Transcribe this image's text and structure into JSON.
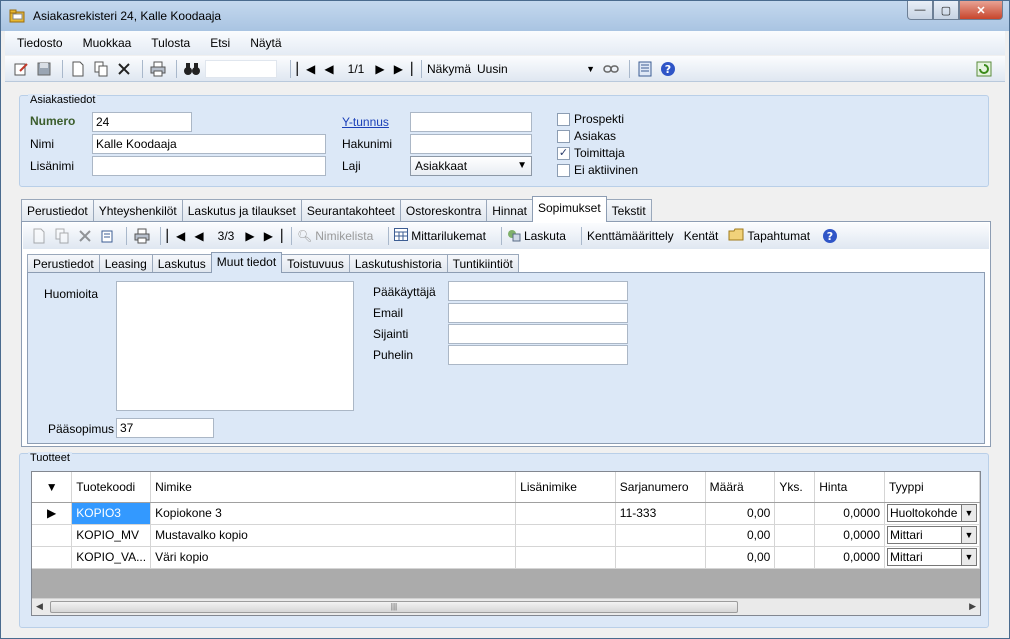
{
  "window": {
    "title": "Asiakasrekisteri 24, Kalle Koodaaja",
    "controls": {
      "minimize": "—",
      "maximize": "▢",
      "close": "✕"
    }
  },
  "menu": [
    "Tiedosto",
    "Muokkaa",
    "Tulosta",
    "Etsi",
    "Näytä"
  ],
  "toolbar": {
    "record_position": "1/1",
    "view_label": "Näkymä",
    "view_value": "Uusin"
  },
  "customer": {
    "group_title": "Asiakastiedot",
    "numero_label": "Numero",
    "numero_value": "24",
    "nimi_label": "Nimi",
    "nimi_value": "Kalle Koodaaja",
    "lisanimi_label": "Lisänimi",
    "lisanimi_value": "",
    "ytunnus_label": "Y-tunnus",
    "ytunnus_value": "",
    "hakunimi_label": "Hakunimi",
    "hakunimi_value": "",
    "laji_label": "Laji",
    "laji_value": "Asiakkaat",
    "checks": [
      {
        "label": "Prospekti",
        "checked": false
      },
      {
        "label": "Asiakas",
        "checked": false
      },
      {
        "label": "Toimittaja",
        "checked": true
      },
      {
        "label": "Ei aktiivinen",
        "checked": false
      }
    ]
  },
  "main_tabs": [
    "Perustiedot",
    "Yhteyshenkilöt",
    "Laskutus ja tilaukset",
    "Seurantakohteet",
    "Ostoreskontra",
    "Hinnat",
    "Sopimukset",
    "Tekstit"
  ],
  "main_tab_active": 6,
  "contract_toolbar": {
    "position": "3/3",
    "nimikelista": "Nimikelista",
    "mittarilukemat": "Mittarilukemat",
    "laskuta": "Laskuta",
    "kenttamaarittely": "Kenttämäärittely",
    "kentat": "Kentät",
    "tapahtumat": "Tapahtumat"
  },
  "sub_tabs": [
    "Perustiedot",
    "Leasing",
    "Laskutus",
    "Muut tiedot",
    "Toistuvuus",
    "Laskutushistoria",
    "Tuntikiintiöt"
  ],
  "sub_tab_active": 3,
  "other": {
    "huomioita_label": "Huomioita",
    "huomioita_value": "",
    "paasopimus_label": "Pääsopimus",
    "paasopimus_value": "37",
    "paakayttaja_label": "Pääkäyttäjä",
    "paakayttaja_value": "",
    "email_label": "Email",
    "email_value": "",
    "sijainti_label": "Sijainti",
    "sijainti_value": "",
    "puhelin_label": "Puhelin",
    "puhelin_value": ""
  },
  "products": {
    "group_title": "Tuotteet",
    "columns": [
      "Tuotekoodi",
      "Nimike",
      "Lisänimike",
      "Sarjanumero",
      "Määrä",
      "Yks.",
      "Hinta",
      "Tyyppi"
    ],
    "rows": [
      {
        "code": "KOPIO3",
        "name": "Kopiokone 3",
        "extra": "",
        "serial": "11-333",
        "qty": "0,00",
        "unit": "",
        "price": "0,0000",
        "type": "Huoltokohde"
      },
      {
        "code": "KOPIO_MV",
        "name": "Mustavalko kopio",
        "extra": "",
        "serial": "",
        "qty": "0,00",
        "unit": "",
        "price": "0,0000",
        "type": "Mittari"
      },
      {
        "code": "KOPIO_VA...",
        "name": "Väri kopio",
        "extra": "",
        "serial": "",
        "qty": "0,00",
        "unit": "",
        "price": "0,0000",
        "type": "Mittari"
      }
    ]
  },
  "colors": {
    "accent": "#3399ff",
    "group_bg": "#dce8f7",
    "link": "#1a3fb8"
  }
}
